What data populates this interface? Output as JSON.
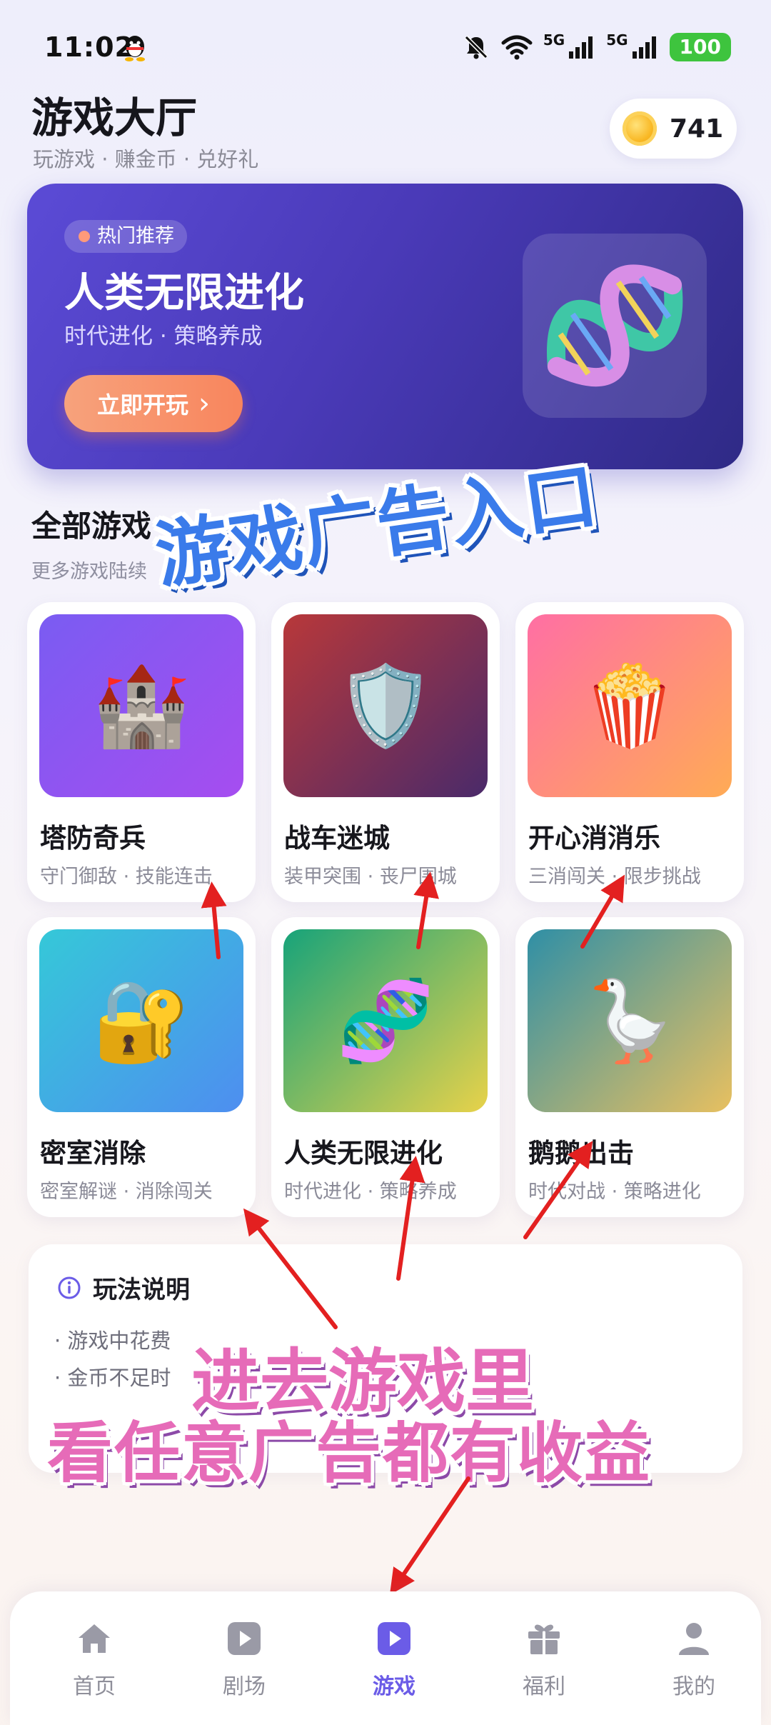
{
  "status_bar": {
    "time": "11:02",
    "signal1_label": "5G",
    "signal2_label": "5G",
    "battery": "100"
  },
  "header": {
    "title": "游戏大厅",
    "subtitle": "玩游戏 · 赚金币 · 兑好礼",
    "coins": "741"
  },
  "banner": {
    "tag": "热门推荐",
    "title": "人类无限进化",
    "subtitle": "时代进化 · 策略养成",
    "button_label": "立即开玩",
    "button_arrow": "›"
  },
  "section": {
    "title": "全部游戏",
    "subtitle": "更多游戏陆续"
  },
  "games": [
    {
      "name": "塔防奇兵",
      "tags": "守门御敌 · 技能连击",
      "icon": "castle-icon",
      "emoji": "🏰"
    },
    {
      "name": "战车迷城",
      "tags": "装甲突围 · 丧尸围城",
      "icon": "shield-icon",
      "emoji": "🛡️"
    },
    {
      "name": "开心消消乐",
      "tags": "三消闯关 · 限步挑战",
      "icon": "popcorn-icon",
      "emoji": "🍿"
    },
    {
      "name": "密室消除",
      "tags": "密室解谜 · 消除闯关",
      "icon": "lock-key-icon",
      "emoji": "🔐"
    },
    {
      "name": "人类无限进化",
      "tags": "时代进化 · 策略养成",
      "icon": "dna-icon",
      "emoji": "🧬"
    },
    {
      "name": "鹅鹅出击",
      "tags": "时代对战 · 策略进化",
      "icon": "goose-icon",
      "emoji": "🪿"
    }
  ],
  "howto": {
    "title": "玩法说明",
    "line1": "· 游戏中花费",
    "line2": "· 金币不足时"
  },
  "overlay": {
    "line1": "游戏广告入口",
    "line2": "进去游戏里",
    "line3": "看任意广告都有收益"
  },
  "nav": [
    {
      "label": "首页",
      "icon": "home-icon"
    },
    {
      "label": "剧场",
      "icon": "play-square-icon"
    },
    {
      "label": "游戏",
      "icon": "game-play-icon"
    },
    {
      "label": "福利",
      "icon": "gift-icon"
    },
    {
      "label": "我的",
      "icon": "profile-icon"
    }
  ],
  "colors": {
    "accent": "#6b5ce7",
    "banner_start": "#5b4bd6",
    "banner_end": "#2f2a86",
    "play_button": "#f8855d",
    "overlay_blue": "#3a7bea",
    "overlay_pink": "#e66bb8",
    "arrow_red": "#e32020"
  }
}
